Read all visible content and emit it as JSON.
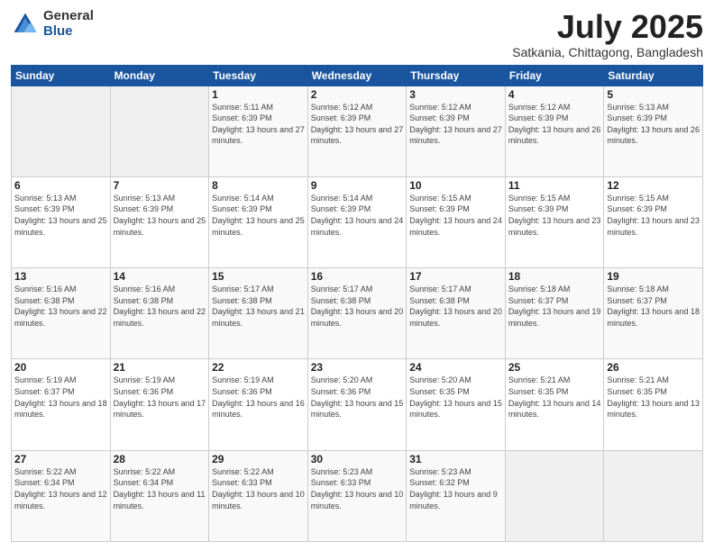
{
  "logo": {
    "general": "General",
    "blue": "Blue"
  },
  "title": {
    "main": "July 2025",
    "sub": "Satkania, Chittagong, Bangladesh"
  },
  "weekdays": [
    "Sunday",
    "Monday",
    "Tuesday",
    "Wednesday",
    "Thursday",
    "Friday",
    "Saturday"
  ],
  "weeks": [
    [
      {
        "day": "",
        "info": ""
      },
      {
        "day": "",
        "info": ""
      },
      {
        "day": "1",
        "info": "Sunrise: 5:11 AM\nSunset: 6:39 PM\nDaylight: 13 hours and 27 minutes."
      },
      {
        "day": "2",
        "info": "Sunrise: 5:12 AM\nSunset: 6:39 PM\nDaylight: 13 hours and 27 minutes."
      },
      {
        "day": "3",
        "info": "Sunrise: 5:12 AM\nSunset: 6:39 PM\nDaylight: 13 hours and 27 minutes."
      },
      {
        "day": "4",
        "info": "Sunrise: 5:12 AM\nSunset: 6:39 PM\nDaylight: 13 hours and 26 minutes."
      },
      {
        "day": "5",
        "info": "Sunrise: 5:13 AM\nSunset: 6:39 PM\nDaylight: 13 hours and 26 minutes."
      }
    ],
    [
      {
        "day": "6",
        "info": "Sunrise: 5:13 AM\nSunset: 6:39 PM\nDaylight: 13 hours and 25 minutes."
      },
      {
        "day": "7",
        "info": "Sunrise: 5:13 AM\nSunset: 6:39 PM\nDaylight: 13 hours and 25 minutes."
      },
      {
        "day": "8",
        "info": "Sunrise: 5:14 AM\nSunset: 6:39 PM\nDaylight: 13 hours and 25 minutes."
      },
      {
        "day": "9",
        "info": "Sunrise: 5:14 AM\nSunset: 6:39 PM\nDaylight: 13 hours and 24 minutes."
      },
      {
        "day": "10",
        "info": "Sunrise: 5:15 AM\nSunset: 6:39 PM\nDaylight: 13 hours and 24 minutes."
      },
      {
        "day": "11",
        "info": "Sunrise: 5:15 AM\nSunset: 6:39 PM\nDaylight: 13 hours and 23 minutes."
      },
      {
        "day": "12",
        "info": "Sunrise: 5:15 AM\nSunset: 6:39 PM\nDaylight: 13 hours and 23 minutes."
      }
    ],
    [
      {
        "day": "13",
        "info": "Sunrise: 5:16 AM\nSunset: 6:38 PM\nDaylight: 13 hours and 22 minutes."
      },
      {
        "day": "14",
        "info": "Sunrise: 5:16 AM\nSunset: 6:38 PM\nDaylight: 13 hours and 22 minutes."
      },
      {
        "day": "15",
        "info": "Sunrise: 5:17 AM\nSunset: 6:38 PM\nDaylight: 13 hours and 21 minutes."
      },
      {
        "day": "16",
        "info": "Sunrise: 5:17 AM\nSunset: 6:38 PM\nDaylight: 13 hours and 20 minutes."
      },
      {
        "day": "17",
        "info": "Sunrise: 5:17 AM\nSunset: 6:38 PM\nDaylight: 13 hours and 20 minutes."
      },
      {
        "day": "18",
        "info": "Sunrise: 5:18 AM\nSunset: 6:37 PM\nDaylight: 13 hours and 19 minutes."
      },
      {
        "day": "19",
        "info": "Sunrise: 5:18 AM\nSunset: 6:37 PM\nDaylight: 13 hours and 18 minutes."
      }
    ],
    [
      {
        "day": "20",
        "info": "Sunrise: 5:19 AM\nSunset: 6:37 PM\nDaylight: 13 hours and 18 minutes."
      },
      {
        "day": "21",
        "info": "Sunrise: 5:19 AM\nSunset: 6:36 PM\nDaylight: 13 hours and 17 minutes."
      },
      {
        "day": "22",
        "info": "Sunrise: 5:19 AM\nSunset: 6:36 PM\nDaylight: 13 hours and 16 minutes."
      },
      {
        "day": "23",
        "info": "Sunrise: 5:20 AM\nSunset: 6:36 PM\nDaylight: 13 hours and 15 minutes."
      },
      {
        "day": "24",
        "info": "Sunrise: 5:20 AM\nSunset: 6:35 PM\nDaylight: 13 hours and 15 minutes."
      },
      {
        "day": "25",
        "info": "Sunrise: 5:21 AM\nSunset: 6:35 PM\nDaylight: 13 hours and 14 minutes."
      },
      {
        "day": "26",
        "info": "Sunrise: 5:21 AM\nSunset: 6:35 PM\nDaylight: 13 hours and 13 minutes."
      }
    ],
    [
      {
        "day": "27",
        "info": "Sunrise: 5:22 AM\nSunset: 6:34 PM\nDaylight: 13 hours and 12 minutes."
      },
      {
        "day": "28",
        "info": "Sunrise: 5:22 AM\nSunset: 6:34 PM\nDaylight: 13 hours and 11 minutes."
      },
      {
        "day": "29",
        "info": "Sunrise: 5:22 AM\nSunset: 6:33 PM\nDaylight: 13 hours and 10 minutes."
      },
      {
        "day": "30",
        "info": "Sunrise: 5:23 AM\nSunset: 6:33 PM\nDaylight: 13 hours and 10 minutes."
      },
      {
        "day": "31",
        "info": "Sunrise: 5:23 AM\nSunset: 6:32 PM\nDaylight: 13 hours and 9 minutes."
      },
      {
        "day": "",
        "info": ""
      },
      {
        "day": "",
        "info": ""
      }
    ]
  ]
}
